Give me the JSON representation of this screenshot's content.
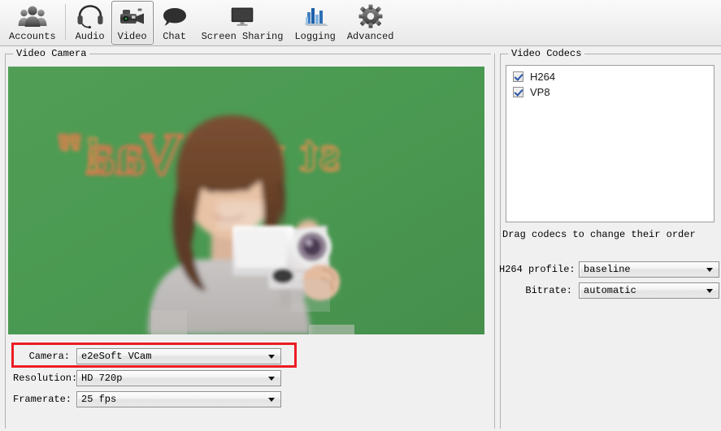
{
  "window": {
    "background": "#f0f0f0",
    "accent_highlight": "#ec1c24"
  },
  "toolbar": {
    "items": [
      {
        "id": "accounts",
        "label": "Accounts",
        "icon": "accounts-icon",
        "selected": false
      },
      {
        "id": "audio",
        "label": "Audio",
        "icon": "headset-icon",
        "selected": false
      },
      {
        "id": "video",
        "label": "Video",
        "icon": "camcorder-icon",
        "selected": true
      },
      {
        "id": "chat",
        "label": "Chat",
        "icon": "speech-bubble-icon",
        "selected": false
      },
      {
        "id": "screen-sharing",
        "label": "Screen Sharing",
        "icon": "monitor-icon",
        "selected": false
      },
      {
        "id": "logging",
        "label": "Logging",
        "icon": "bar-chart-icon",
        "selected": false
      },
      {
        "id": "advanced",
        "label": "Advanced",
        "icon": "gear-icon",
        "selected": false
      }
    ]
  },
  "video_camera": {
    "group_title": "Video Camera",
    "preview": {
      "description": "Live camera preview: woman holding a white camcorder in front of a green screen backdrop with mirrored orange outlined lettering",
      "background_color": "#4e9b54"
    },
    "controls": [
      {
        "id": "camera",
        "label": "Camera:",
        "value": "e2eSoft VCam",
        "highlighted": true
      },
      {
        "id": "resolution",
        "label": "Resolution:",
        "value": "HD 720p",
        "highlighted": false
      },
      {
        "id": "framerate",
        "label": "Framerate:",
        "value": "25 fps",
        "highlighted": false
      }
    ]
  },
  "video_codecs": {
    "group_title": "Video Codecs",
    "codecs": [
      {
        "name": "H264",
        "checked": true
      },
      {
        "name": "VP8",
        "checked": true
      }
    ],
    "hint": "Drag codecs to change their order",
    "settings": [
      {
        "id": "h264-profile",
        "label": "H264 profile:",
        "value": "baseline"
      },
      {
        "id": "bitrate",
        "label": "Bitrate:",
        "value": "automatic"
      }
    ]
  }
}
